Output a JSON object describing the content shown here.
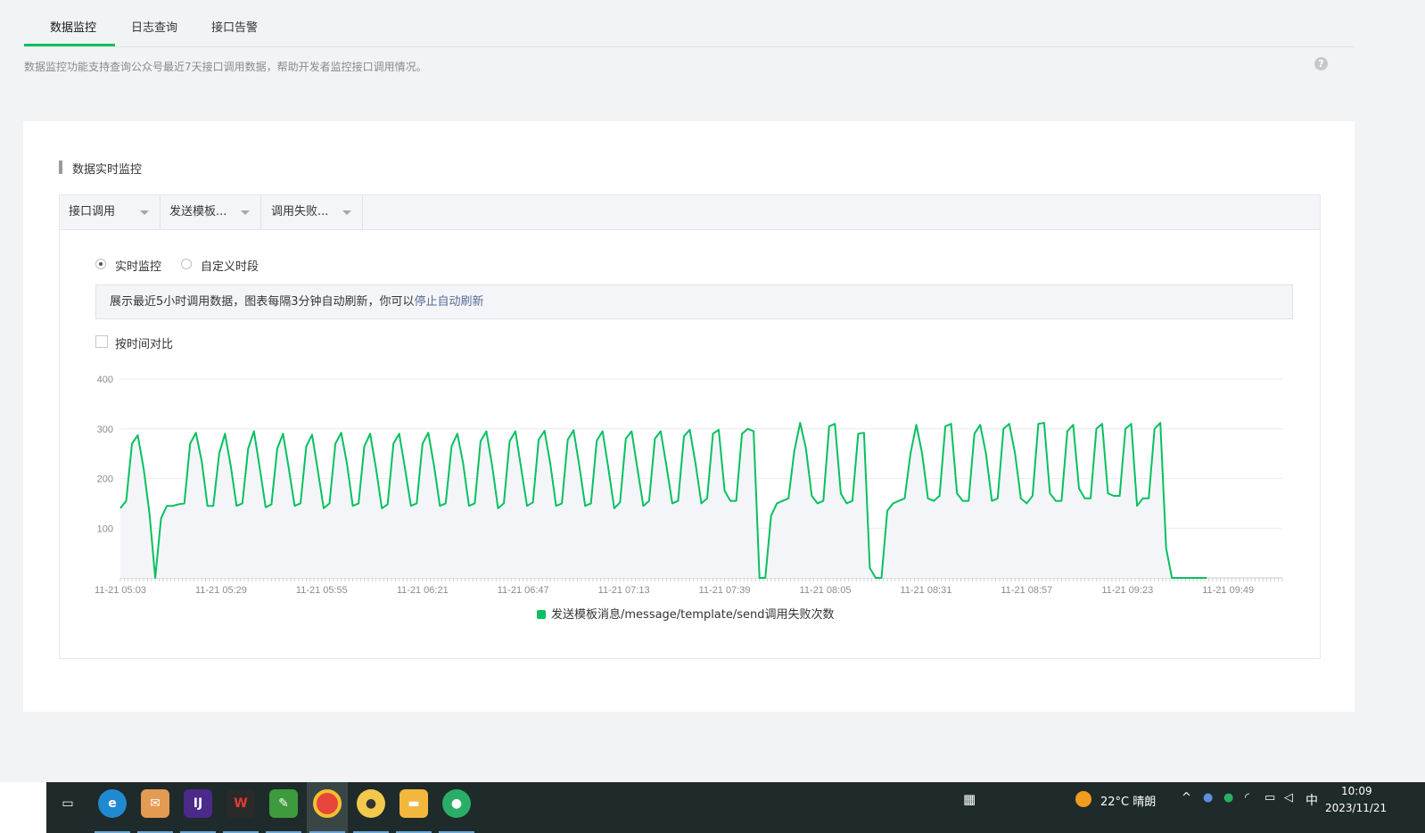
{
  "tabs": [
    {
      "label": "数据监控"
    },
    {
      "label": "日志查询"
    },
    {
      "label": "接口告警"
    }
  ],
  "description": "数据监控功能支持查询公众号最近7天接口调用数据，帮助开发者监控接口调用情况。",
  "help_icon": "?",
  "section_title": "数据实时监控",
  "filters": [
    {
      "label": "接口调用"
    },
    {
      "label": "发送模板..."
    },
    {
      "label": "调用失败..."
    }
  ],
  "mode": {
    "options": [
      {
        "label": "实时监控",
        "checked": true
      },
      {
        "label": "自定义时段",
        "checked": false
      }
    ]
  },
  "notice": {
    "text": "展示最近5小时调用数据，图表每隔3分钟自动刷新，你可以",
    "link": "停止自动刷新"
  },
  "compare": {
    "label": "按时间对比",
    "checked": false
  },
  "chart_data": {
    "type": "area",
    "y_ticks": [
      "100",
      "200",
      "300",
      "400"
    ],
    "ylim": [
      0,
      400
    ],
    "x_ticks": [
      "11-21 05:03",
      "11-21 05:29",
      "11-21 05:55",
      "11-21 06:21",
      "11-21 06:47",
      "11-21 07:13",
      "11-21 07:39",
      "11-21 08:05",
      "11-21 08:31",
      "11-21 08:57",
      "11-21 09:23",
      "11-21 09:49"
    ],
    "x_range_minutes": [
      0,
      300
    ],
    "grid": true,
    "legend_position": "bottom-center",
    "series": [
      {
        "name": "发送模板消息/message/template/send调用失败次数",
        "color": "#07c160",
        "values": [
          140,
          155,
          270,
          287,
          220,
          130,
          0,
          120,
          145,
          145,
          148,
          150,
          270,
          292,
          235,
          145,
          145,
          250,
          290,
          225,
          145,
          150,
          260,
          295,
          220,
          142,
          148,
          260,
          290,
          220,
          145,
          150,
          265,
          288,
          215,
          140,
          150,
          270,
          292,
          230,
          145,
          150,
          265,
          290,
          220,
          140,
          148,
          270,
          290,
          220,
          145,
          150,
          270,
          292,
          225,
          145,
          150,
          265,
          290,
          230,
          145,
          150,
          275,
          295,
          225,
          140,
          150,
          275,
          295,
          220,
          145,
          152,
          278,
          296,
          230,
          145,
          150,
          278,
          297,
          225,
          145,
          150,
          276,
          295,
          220,
          140,
          152,
          280,
          295,
          220,
          145,
          155,
          280,
          295,
          225,
          150,
          155,
          285,
          298,
          230,
          150,
          160,
          290,
          298,
          175,
          155,
          155,
          290,
          300,
          295,
          0,
          0,
          125,
          150,
          155,
          160,
          255,
          312,
          260,
          165,
          150,
          155,
          305,
          310,
          170,
          150,
          155,
          290,
          292,
          20,
          0,
          0,
          135,
          150,
          155,
          160,
          250,
          308,
          250,
          160,
          155,
          165,
          305,
          310,
          170,
          155,
          155,
          290,
          308,
          250,
          155,
          160,
          300,
          310,
          250,
          160,
          150,
          165,
          310,
          312,
          170,
          155,
          155,
          295,
          308,
          180,
          160,
          160,
          300,
          310,
          170,
          165,
          165,
          300,
          310,
          145,
          160,
          160,
          300,
          312,
          60,
          0,
          0,
          0,
          0,
          0,
          0,
          0
        ]
      }
    ]
  },
  "taskbar": {
    "weather": "22°C  晴朗",
    "ime": "中",
    "time": "10:09",
    "date": "2023/11/21",
    "apps": [
      "task-view-icon",
      "edge-icon",
      "mail-icon",
      "ide-icon",
      "wps-icon",
      "notepad-icon",
      "chrome-icon",
      "bird-icon",
      "folder-icon",
      "wechat-icon"
    ]
  }
}
